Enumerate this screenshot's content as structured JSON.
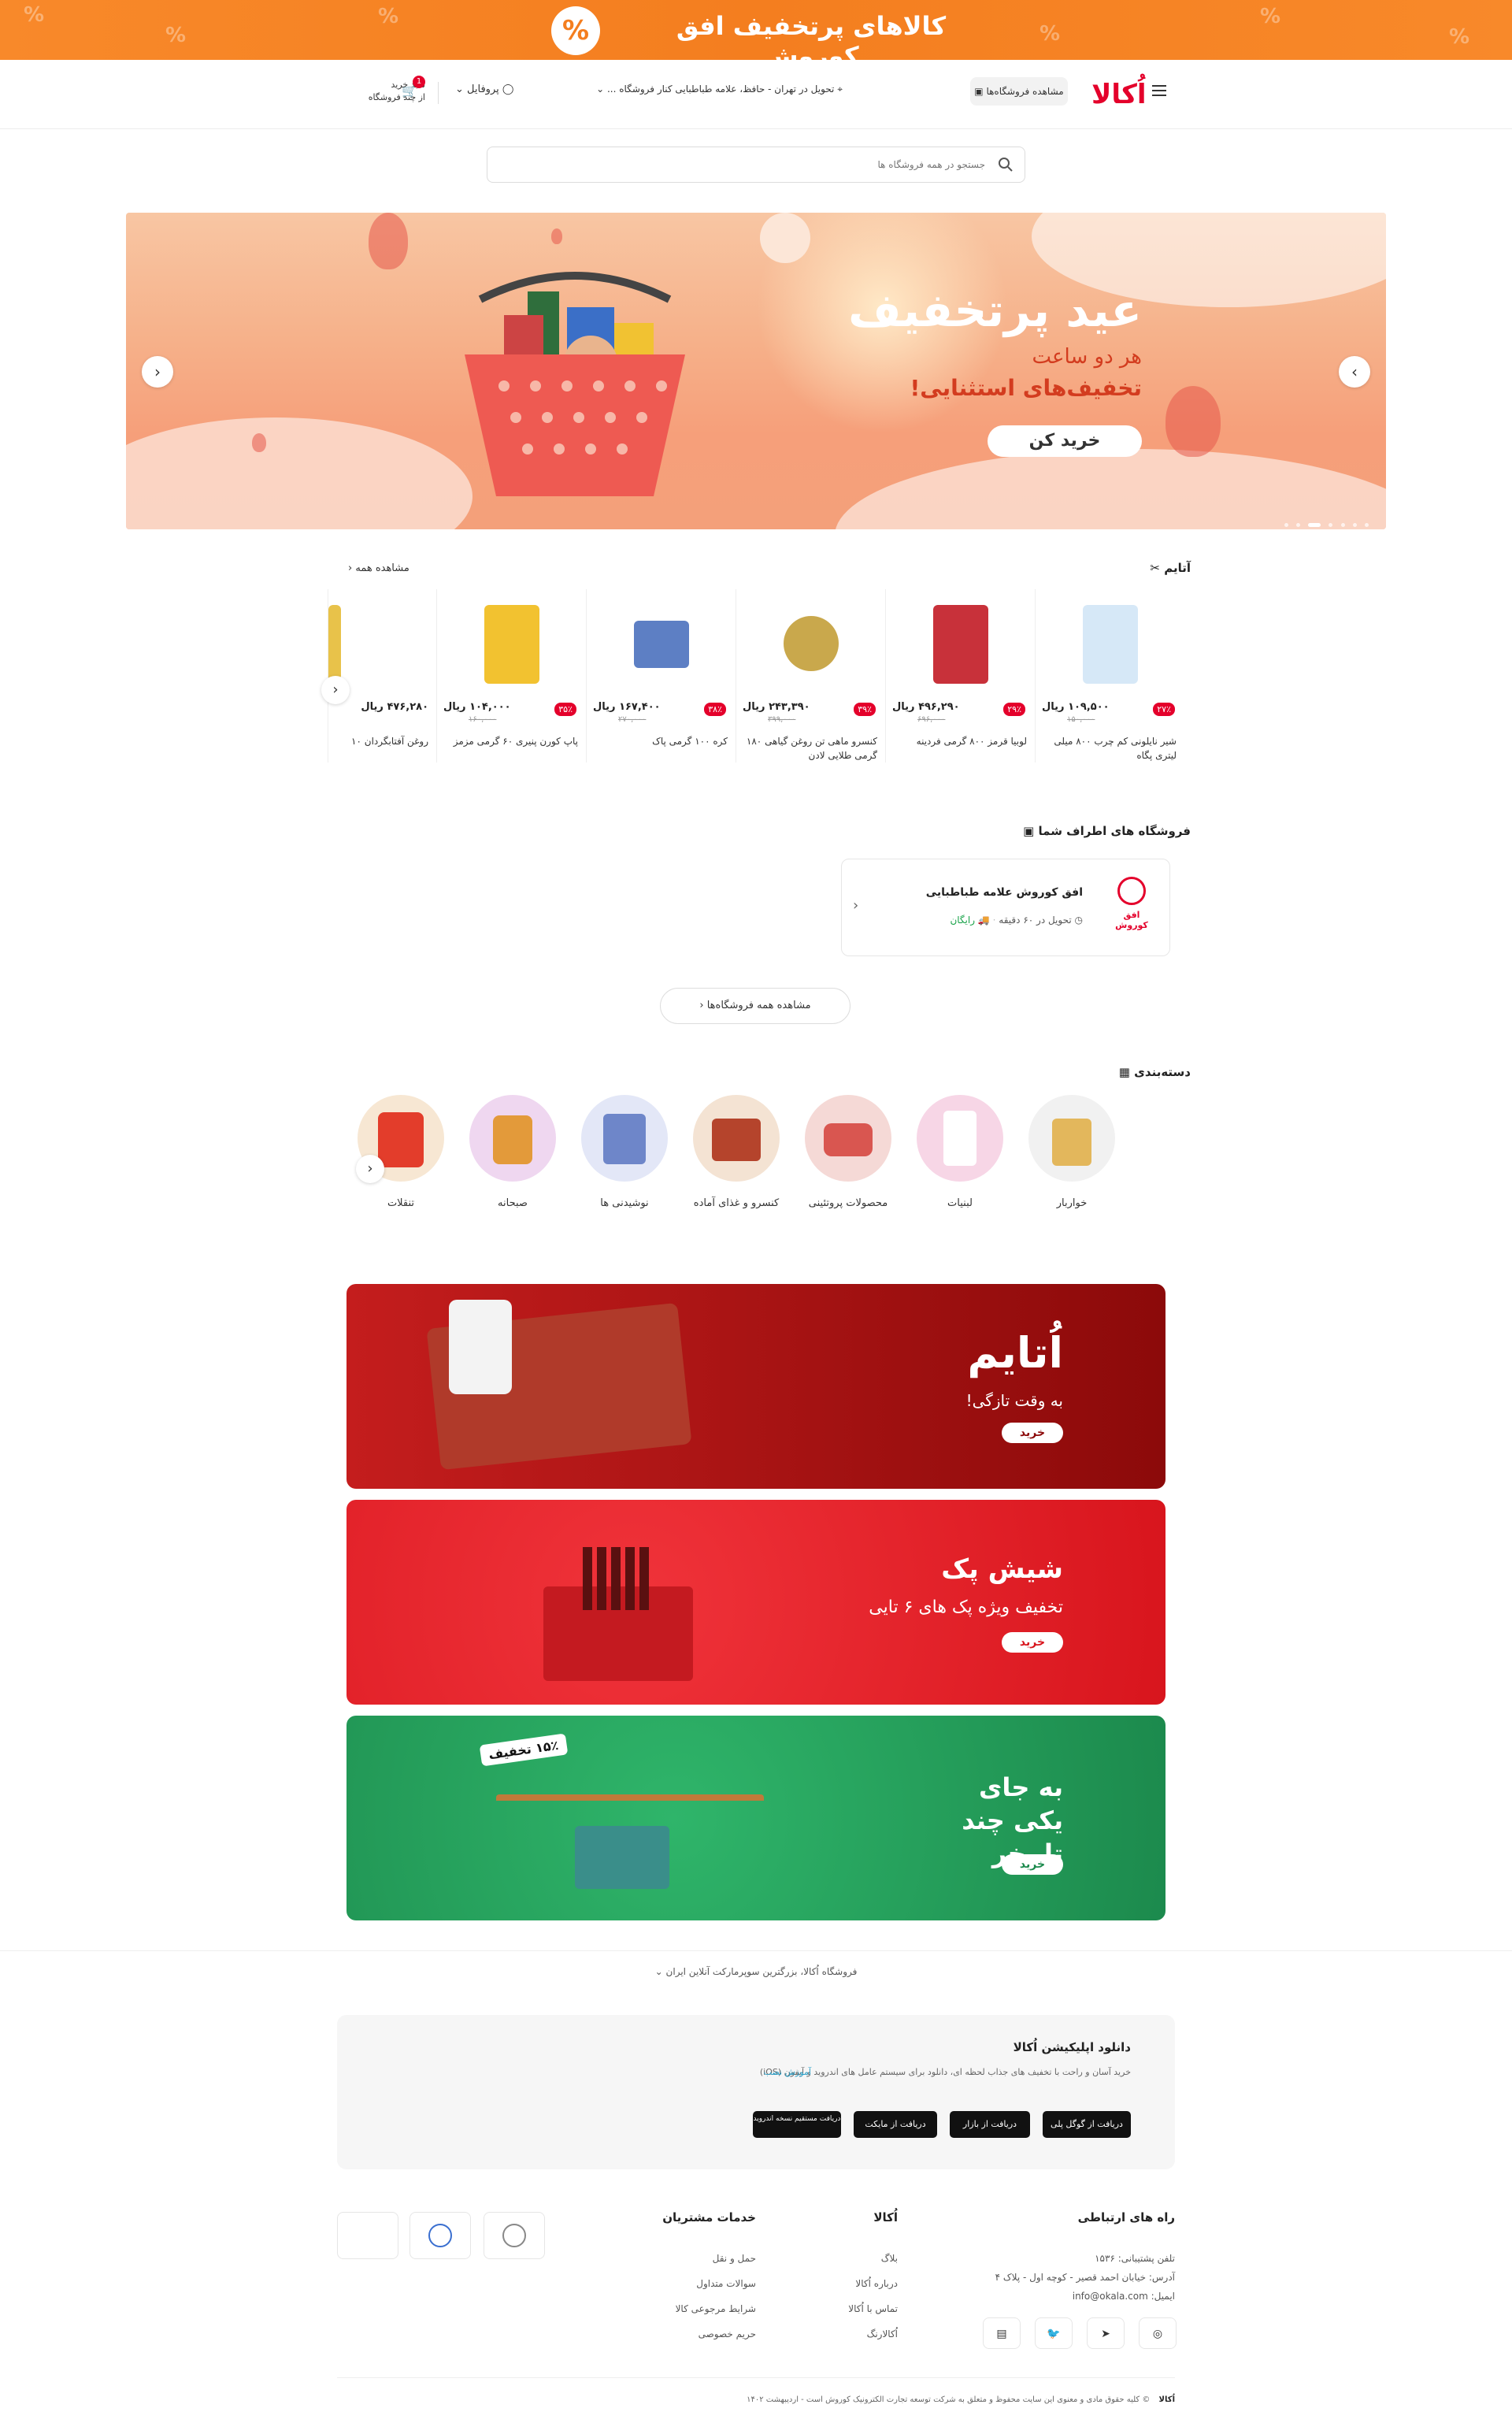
{
  "promo": {
    "title": "کالاهای پرتخفیف افق کوروش",
    "badge": "%"
  },
  "header": {
    "logo": "اُکالا",
    "stores_button": "مشاهده فروشگاه‌ها",
    "delivery": "تحویل در تهران - حافظ، علامه طباطبایی کنار فروشگاه ...",
    "profile": "پروفایل",
    "cart_line1": "سبد خرید",
    "cart_line2": "از چند فروشگاه",
    "cart_count": "1"
  },
  "search": {
    "placeholder": "جستجو در همه فروشگاه ها"
  },
  "hero": {
    "title": "عید پرتخفیف",
    "line1": "هر دو ساعت",
    "line2": "تخفیف‌های استثنایی!",
    "button": "خرید کن"
  },
  "atayem": {
    "title": "آتایم",
    "see_all": "مشاهده همه",
    "currency": "ریال",
    "products": [
      {
        "name": "شیر نایلونی کم چرب ۸۰۰ میلی لیتری پگاه",
        "price": "۱۰۹,۵۰۰",
        "old": "۱۵۰,۰۰۰",
        "discount": "۲۷٪",
        "color": "#d6e8f7"
      },
      {
        "name": "لوبیا قرمز ۸۰۰ گرمی فردینه",
        "price": "۴۹۶,۲۹۰",
        "old": "۶۹۶,۰۰۰",
        "discount": "۲۹٪",
        "color": "#c8313a"
      },
      {
        "name": "کنسرو ماهی تن روغن گیاهی ۱۸۰ گرمی طلایی لادن",
        "price": "۲۴۳,۳۹۰",
        "old": "۳۹۹,۰۰۰",
        "discount": "۳۹٪",
        "color": "#c9a84c"
      },
      {
        "name": "کره ۱۰۰ گرمی پاک",
        "price": "۱۶۷,۴۰۰",
        "old": "۲۷۰,۰۰۰",
        "discount": "۳۸٪",
        "color": "#5d7fc4"
      },
      {
        "name": "پاپ کورن پنیری ۶۰ گرمی مزمز",
        "price": "۱۰۴,۰۰۰",
        "old": "۱۶۰,۰۰۰",
        "discount": "۳۵٪",
        "color": "#f2c230"
      },
      {
        "name": "روغن آفتابگردان ۱۰",
        "price": "۴۷۶,۲۸۰",
        "old": "",
        "discount": "",
        "color": "#e8c24a"
      }
    ]
  },
  "nearby": {
    "title": "فروشگاه های اطراف شما",
    "store_name": "افق کوروش علامه طباطبایی",
    "delivery_time": "تحویل در ۶۰ دقیقه",
    "delivery_cost": "رایگان",
    "logo_text": "افق کوروش",
    "all_stores": "مشاهده همه فروشگاه‌ها"
  },
  "categories": {
    "title": "دسته‌بندی",
    "items": [
      {
        "label": "خواربار",
        "color": "#f1f1f1"
      },
      {
        "label": "لبنیات",
        "color": "#f7d6e6"
      },
      {
        "label": "محصولات پروتئینی",
        "color": "#f5d9d6"
      },
      {
        "label": "کنسرو و غذای آماده",
        "color": "#f4e3d3"
      },
      {
        "label": "نوشیدنی ها",
        "color": "#e3e7f7"
      },
      {
        "label": "صبحانه",
        "color": "#efd7f0"
      },
      {
        "label": "تنقلات",
        "color": "#f7e7d3"
      }
    ]
  },
  "banners": [
    {
      "title": "اُتایم",
      "sub": "به وقت تازگی!",
      "button": "خرید"
    },
    {
      "title": "شیش پک",
      "sub": "تخفیف ویژه پک های ۶ تایی",
      "button": "خرید"
    },
    {
      "title": "به جای یکی چند تا بخر",
      "sub": "",
      "badge": "۱۵٪ تخفیف",
      "button": "خرید"
    }
  ],
  "footer": {
    "about": "فروشگاه اُکالا، بزرگترین سوپرمارکت آنلاین ایران",
    "app_title": "دانلود اپلیکیشن اُکالا",
    "app_desc": "خرید آسان و راحت با تخفیف های جذاب لحظه ای، دانلود برای سیستم عامل های اندروید و آیفون (iOS)",
    "app_link": "آموزش نصب",
    "badges": [
      "دریافت از گوگل پلی",
      "دریافت از بازار",
      "دریافت از مایکت",
      "دریافت مستقیم نسخه اندروید"
    ],
    "contact_title": "راه های ارتباطی",
    "phone": "تلفن پشتیبانی: ۱۵۳۶",
    "address": "آدرس: خیابان احمد قصیر - کوچه اول - پلاک ۴",
    "email": "ایمیل: info@okala.com",
    "okala_title": "اُکالا",
    "okala_links": [
      "بلاگ",
      "درباره اُکالا",
      "تماس با اُکالا",
      "اُکالارنگ"
    ],
    "services_title": "خدمات مشتریان",
    "services_links": [
      "حمل و نقل",
      "سوالات متداول",
      "شرایط مرجوعی کالا",
      "حریم خصوصی"
    ],
    "copyright": "© کلیه حقوق مادی و معنوی این سایت محفوظ و متعلق به شرکت توسعه تجارت الکترونیک کوروش است - اردیبهشت ۱۴۰۲"
  },
  "colors": {
    "brand_red": "#e4002b",
    "promo_orange": "#f47e1f",
    "banner1": "#9c0e0e",
    "banner2": "#e8232a",
    "banner3": "#1f9a56"
  }
}
